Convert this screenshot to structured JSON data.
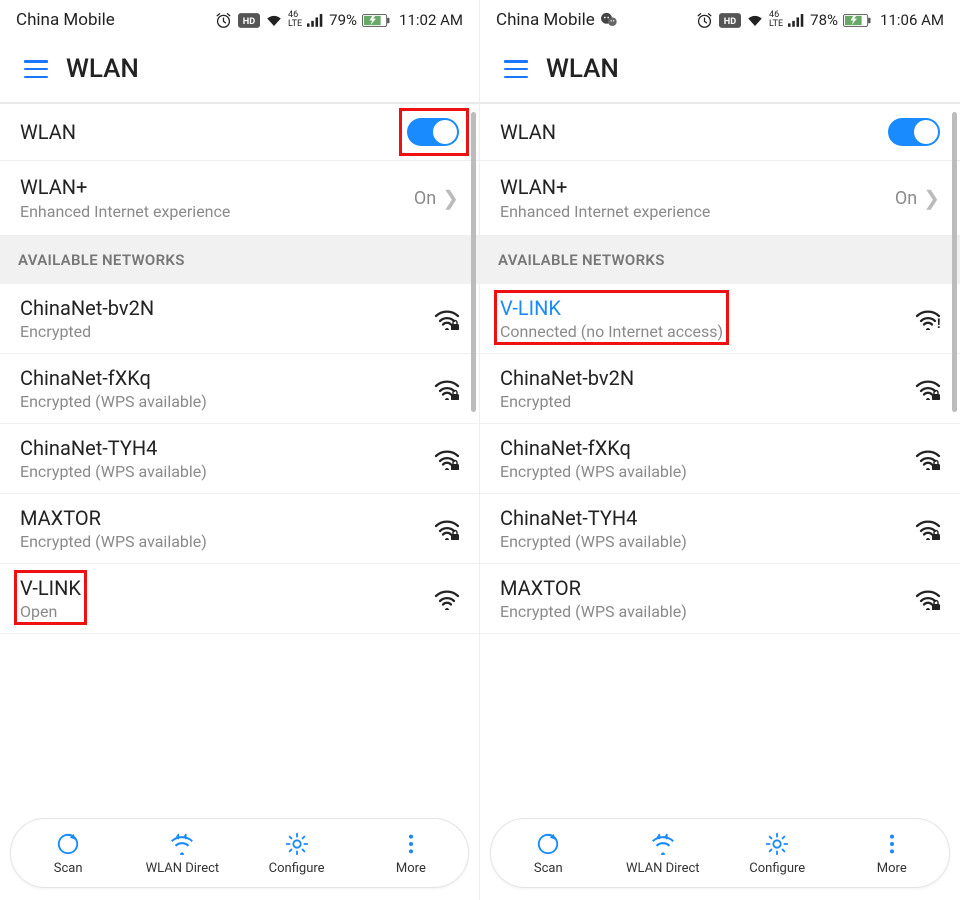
{
  "panes": [
    {
      "status": {
        "carrier": "China Mobile",
        "wechat": false,
        "battery": "79%",
        "time": "11:02 AM"
      },
      "title": "WLAN",
      "main_toggle": {
        "label": "WLAN",
        "on": true,
        "highlight": true
      },
      "wlan_plus": {
        "label": "WLAN+",
        "sub": "Enhanced Internet experience",
        "value": "On"
      },
      "section_label": "AVAILABLE NETWORKS",
      "networks": [
        {
          "name": "ChinaNet-bv2N",
          "desc": "Encrypted",
          "lock": true,
          "connected": false,
          "highlight": false
        },
        {
          "name": "ChinaNet-fXKq",
          "desc": "Encrypted (WPS available)",
          "lock": true,
          "connected": false,
          "highlight": false
        },
        {
          "name": "ChinaNet-TYH4",
          "desc": "Encrypted (WPS available)",
          "lock": true,
          "connected": false,
          "highlight": false
        },
        {
          "name": "MAXTOR",
          "desc": "Encrypted (WPS available)",
          "lock": true,
          "connected": false,
          "highlight": false
        },
        {
          "name": "V-LINK",
          "desc": "Open",
          "lock": false,
          "connected": false,
          "highlight": true
        }
      ],
      "actions": {
        "scan": "Scan",
        "direct": "WLAN Direct",
        "config": "Configure",
        "more": "More"
      }
    },
    {
      "status": {
        "carrier": "China Mobile",
        "wechat": true,
        "battery": "78%",
        "time": "11:06 AM"
      },
      "title": "WLAN",
      "main_toggle": {
        "label": "WLAN",
        "on": true,
        "highlight": false
      },
      "wlan_plus": {
        "label": "WLAN+",
        "sub": "Enhanced Internet experience",
        "value": "On"
      },
      "section_label": "AVAILABLE NETWORKS",
      "networks": [
        {
          "name": "V-LINK",
          "desc": "Connected (no Internet access)",
          "lock": false,
          "connected": true,
          "highlight": true,
          "alert": true
        },
        {
          "name": "ChinaNet-bv2N",
          "desc": "Encrypted",
          "lock": true,
          "connected": false,
          "highlight": false
        },
        {
          "name": "ChinaNet-fXKq",
          "desc": "Encrypted (WPS available)",
          "lock": true,
          "connected": false,
          "highlight": false
        },
        {
          "name": "ChinaNet-TYH4",
          "desc": "Encrypted (WPS available)",
          "lock": true,
          "connected": false,
          "highlight": false
        },
        {
          "name": "MAXTOR",
          "desc": "Encrypted (WPS available)",
          "lock": true,
          "connected": false,
          "highlight": false
        }
      ],
      "actions": {
        "scan": "Scan",
        "direct": "WLAN Direct",
        "config": "Configure",
        "more": "More"
      }
    }
  ]
}
